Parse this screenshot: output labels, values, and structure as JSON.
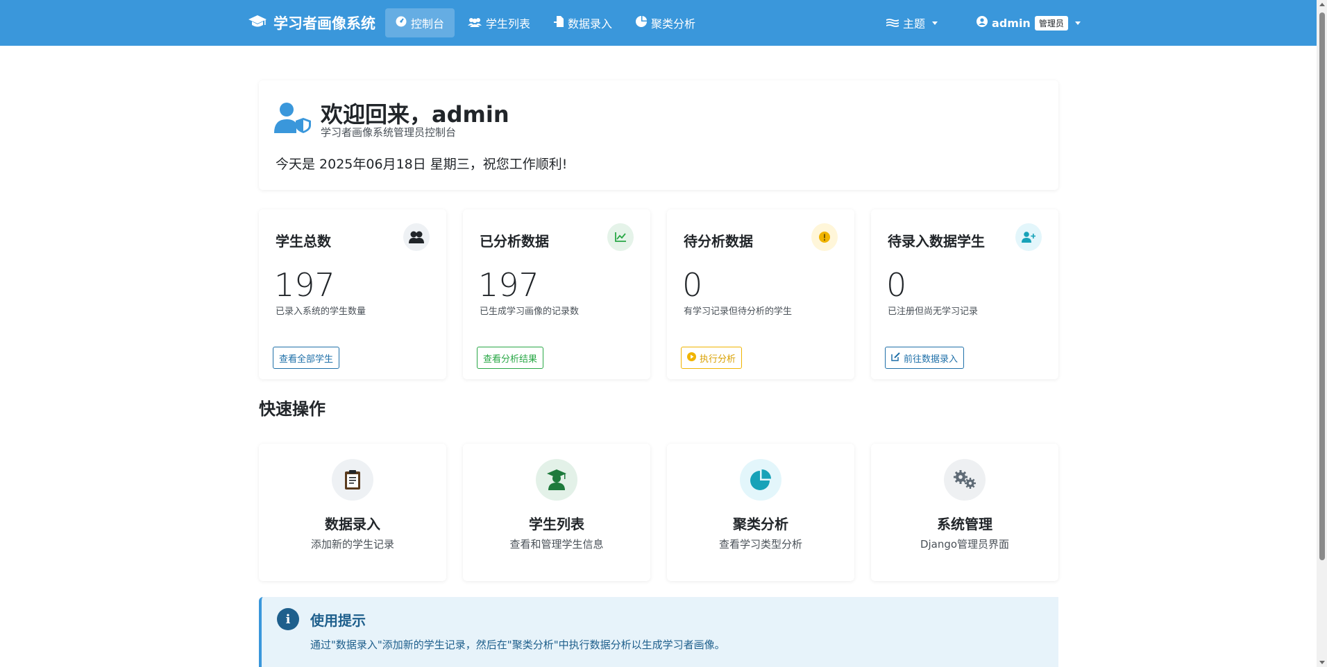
{
  "navbar": {
    "brand": "学习者画像系统",
    "links": [
      {
        "label": "控制台",
        "icon": "dashboard-icon",
        "active": true
      },
      {
        "label": "学生列表",
        "icon": "users-icon"
      },
      {
        "label": "数据录入",
        "icon": "file-import-icon"
      },
      {
        "label": "聚类分析",
        "icon": "pie-chart-icon"
      }
    ],
    "theme_label": "主题",
    "user_name": "admin",
    "user_role": "管理员"
  },
  "welcome": {
    "title": "欢迎回来，admin",
    "subtitle": "学习者画像系统管理员控制台",
    "date_text": "今天是 2025年06月18日 星期三，祝您工作顺利!"
  },
  "stats": [
    {
      "title": "学生总数",
      "value": "197",
      "desc": "已录入系统的学生数量",
      "button": "查看全部学生",
      "icon": "users-icon",
      "color": "#3a97db",
      "icon_bg": "#eef1f4"
    },
    {
      "title": "已分析数据",
      "value": "197",
      "desc": "已生成学习画像的记录数",
      "button": "查看分析结果",
      "icon": "chart-line-icon",
      "color": "#28a745",
      "icon_bg": "#e5f3e9"
    },
    {
      "title": "待分析数据",
      "value": "0",
      "desc": "有学习记录但待分析的学生",
      "button": "执行分析",
      "icon": "exclamation-icon",
      "color": "#f0b400",
      "icon_bg": "#fff6d9"
    },
    {
      "title": "待录入数据学生",
      "value": "0",
      "desc": "已注册但尚无学习记录",
      "button": "前往数据录入",
      "icon": "user-plus-icon",
      "color": "#1e6fa8",
      "icon_bg": "#e3f6fb"
    }
  ],
  "quick_section_title": "快速操作",
  "quick_actions": [
    {
      "title": "数据录入",
      "desc": "添加新的学生记录",
      "icon": "clipboard-icon",
      "icon_bg": "#eef1f4"
    },
    {
      "title": "学生列表",
      "desc": "查看和管理学生信息",
      "icon": "graduate-icon",
      "icon_bg": "#e3f1e8"
    },
    {
      "title": "聚类分析",
      "desc": "查看学习类型分析",
      "icon": "pie-chart-icon",
      "icon_bg": "#e3f6fb"
    },
    {
      "title": "系统管理",
      "desc": "Django管理员界面",
      "icon": "gears-icon",
      "icon_bg": "#eef0f2"
    }
  ],
  "tip": {
    "title": "使用提示",
    "text": "通过\"数据录入\"添加新的学生记录，然后在\"聚类分析\"中执行数据分析以生成学习者画像。"
  }
}
